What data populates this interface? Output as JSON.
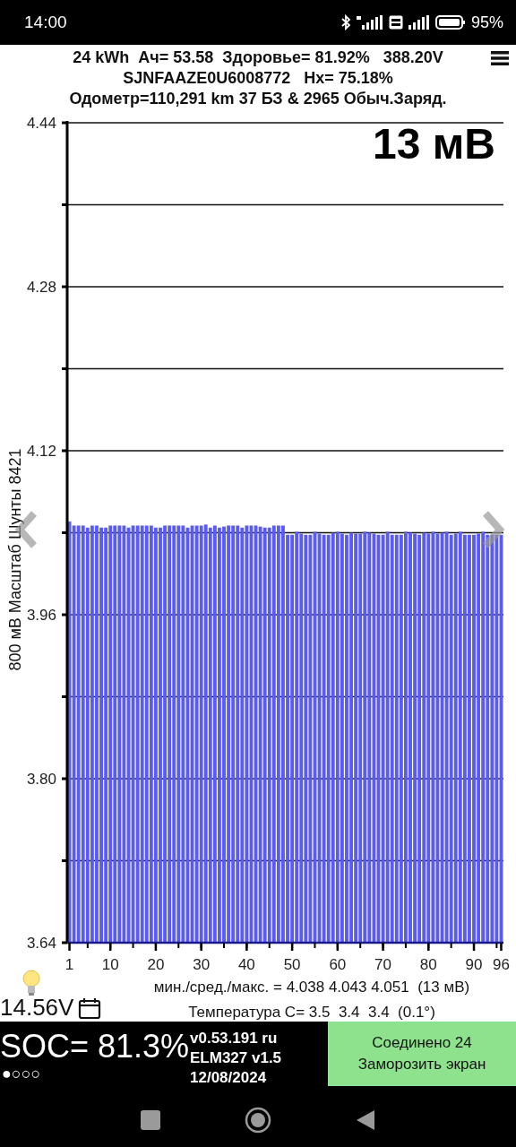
{
  "status_bar": {
    "time": "14:00",
    "battery": "95%"
  },
  "header": {
    "lines": [
      "24 kWh  Ач= 53.58  Здоровье= 81.92%   388.20V",
      "SJNFAAZE0U6008772   Hx= 75.18%",
      "Одометр=110,291 km 37 БЗ & 2965 Обыч.Заряд."
    ]
  },
  "chart": {
    "overlay_reading": "13 мВ",
    "chart_data": {
      "type": "bar",
      "ylabel": "800 мВ Масштаб  Шунты 8421",
      "grid": true,
      "x": [
        1,
        2,
        3,
        4,
        5,
        6,
        7,
        8,
        9,
        10,
        11,
        12,
        13,
        14,
        15,
        16,
        17,
        18,
        19,
        20,
        21,
        22,
        23,
        24,
        25,
        26,
        27,
        28,
        29,
        30,
        31,
        32,
        33,
        34,
        35,
        36,
        37,
        38,
        39,
        40,
        41,
        42,
        43,
        44,
        45,
        46,
        47,
        48,
        49,
        50,
        51,
        52,
        53,
        54,
        55,
        56,
        57,
        58,
        59,
        60,
        61,
        62,
        63,
        64,
        65,
        66,
        67,
        68,
        69,
        70,
        71,
        72,
        73,
        74,
        75,
        76,
        77,
        78,
        79,
        80,
        81,
        82,
        83,
        84,
        85,
        86,
        87,
        88,
        89,
        90,
        91,
        92,
        93,
        94,
        95,
        96
      ],
      "xlim": [
        0.5,
        96.5
      ],
      "values": [
        4.051,
        4.047,
        4.047,
        4.047,
        4.045,
        4.047,
        4.047,
        4.045,
        4.045,
        4.047,
        4.047,
        4.047,
        4.047,
        4.045,
        4.047,
        4.047,
        4.047,
        4.047,
        4.047,
        4.045,
        4.045,
        4.047,
        4.047,
        4.047,
        4.047,
        4.047,
        4.045,
        4.047,
        4.047,
        4.047,
        4.048,
        4.045,
        4.047,
        4.045,
        4.046,
        4.047,
        4.047,
        4.047,
        4.045,
        4.047,
        4.047,
        4.047,
        4.046,
        4.045,
        4.045,
        4.047,
        4.047,
        4.047,
        4.038,
        4.038,
        4.041,
        4.039,
        4.038,
        4.038,
        4.041,
        4.039,
        4.038,
        4.038,
        4.04,
        4.041,
        4.039,
        4.038,
        4.04,
        4.039,
        4.039,
        4.041,
        4.04,
        4.039,
        4.038,
        4.038,
        4.041,
        4.038,
        4.038,
        4.038,
        4.041,
        4.04,
        4.039,
        4.038,
        4.04,
        4.039,
        4.041,
        4.039,
        4.04,
        4.041,
        4.038,
        4.039,
        4.041,
        4.038,
        4.038,
        4.038,
        4.039,
        4.041,
        4.038,
        4.038,
        4.038,
        4.038
      ],
      "ylim": [
        3.64,
        4.44
      ],
      "yticks": [
        {
          "value": 3.64,
          "label": "3.64"
        },
        {
          "value": 3.8,
          "label": "3.80"
        },
        {
          "value": 3.96,
          "label": "3.96"
        },
        {
          "value": 4.12,
          "label": "4.12"
        },
        {
          "value": 4.28,
          "label": "4.28"
        },
        {
          "value": 4.44,
          "label": "4.44"
        }
      ],
      "xticks": [
        1,
        10,
        20,
        30,
        40,
        50,
        60,
        70,
        80,
        90,
        96
      ]
    }
  },
  "stats": {
    "min_avg_max": "мин./сред./макс. = 4.038 4.043 4.051  (13 мВ)",
    "temperature": "Температура C= 3.5  3.4  3.4  (0.1°)"
  },
  "aux_voltage": "14.56V",
  "soc": {
    "text": "SOC= 81.3%",
    "dots": "●○○○"
  },
  "version": {
    "lines": [
      "v0.53.191 ru",
      "ELM327 v1.5",
      "12/08/2024"
    ]
  },
  "status_button": {
    "lines": [
      "Соединено 24",
      "Заморозить экран"
    ]
  }
}
